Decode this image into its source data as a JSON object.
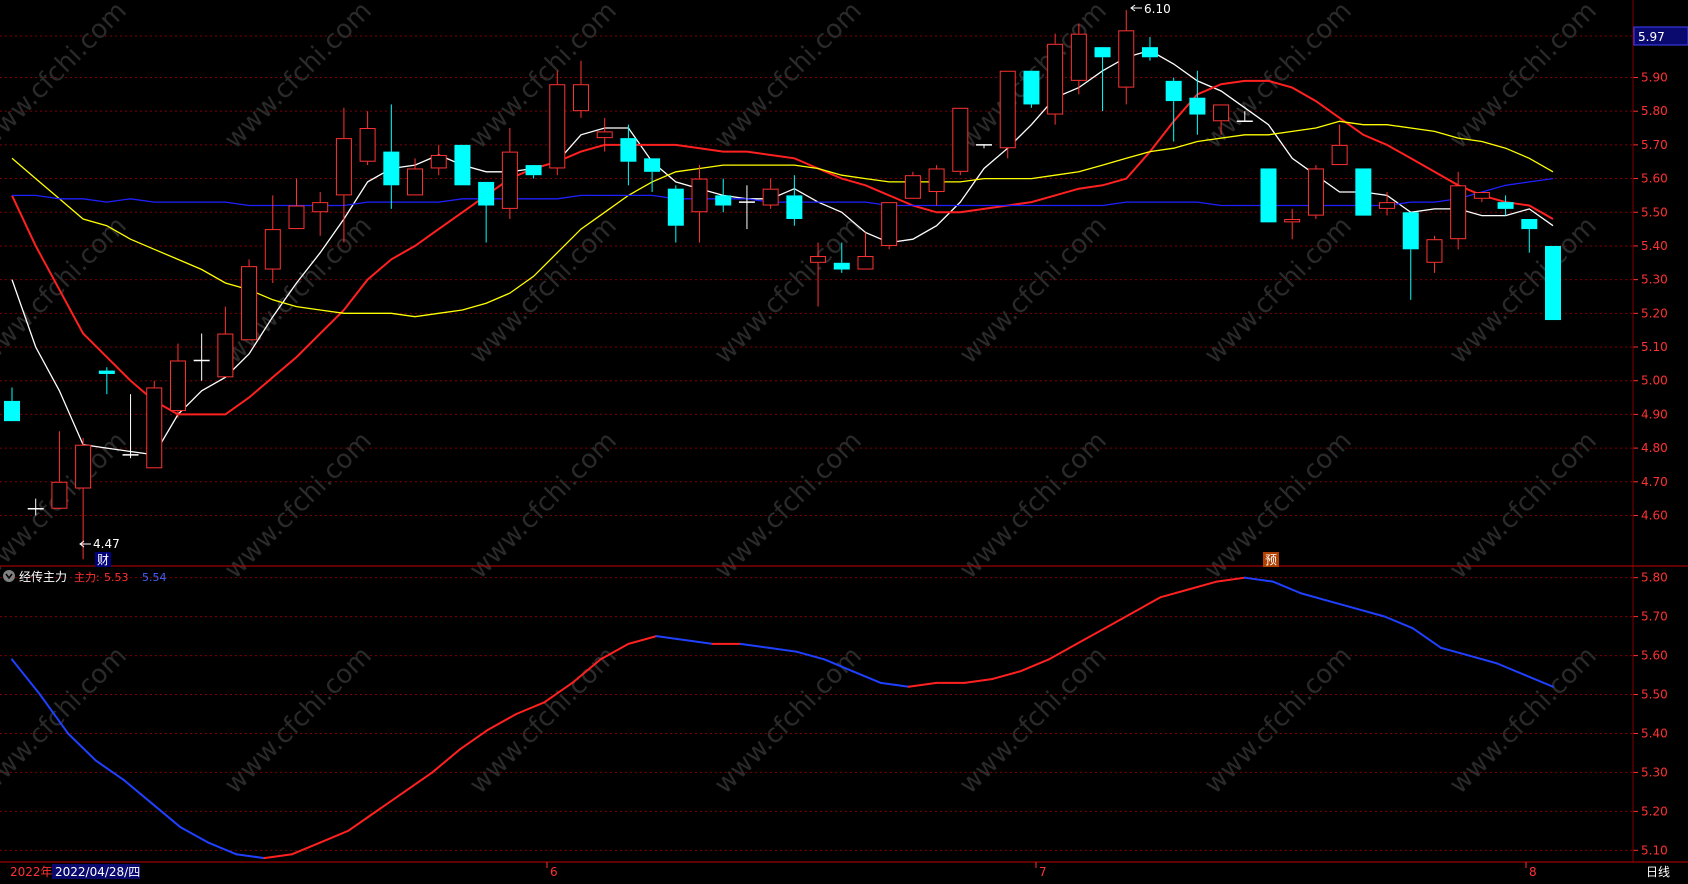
{
  "price_axis": {
    "labels": [
      "5.90",
      "5.80",
      "5.70",
      "5.60",
      "5.50",
      "5.40",
      "5.30",
      "5.20",
      "5.10",
      "5.00",
      "4.90",
      "4.80",
      "4.70",
      "4.60"
    ],
    "current_value": "5.97"
  },
  "indicator_axis": {
    "labels": [
      "5.80",
      "5.70",
      "5.60",
      "5.50",
      "5.40",
      "5.30",
      "5.20",
      "5.10"
    ]
  },
  "indicator_legend": {
    "name": "经传主力",
    "main_label": "主力:",
    "main_value": "5.53",
    "second_label": "",
    "second_value": "5.54"
  },
  "annotations": {
    "low_label": "4.47",
    "high_label": "6.10",
    "finance_marker": "财",
    "forecast_marker": "预"
  },
  "bottom_bar": {
    "year": "2022年",
    "date": "2022/04/28/四",
    "months": [
      "6",
      "7",
      "8"
    ],
    "period": "日线"
  },
  "colors": {
    "up": "#ff3232",
    "down": "#00ffff",
    "ma5": "#ffffff",
    "ma10": "#ff2020",
    "ma20": "#ffff00",
    "ma60": "#2020ff",
    "axis_text": "#ff3232",
    "grid": "#800000"
  },
  "chart_data": {
    "type": "candlestick",
    "period": "daily",
    "y_range": [
      4.45,
      6.13
    ],
    "candles": [
      {
        "o": 4.94,
        "h": 4.98,
        "l": 4.88,
        "c": 4.88
      },
      {
        "o": 4.62,
        "h": 4.65,
        "l": 4.6,
        "c": 4.62
      },
      {
        "o": 4.62,
        "h": 4.85,
        "l": 4.62,
        "c": 4.7
      },
      {
        "o": 4.68,
        "h": 4.83,
        "l": 4.47,
        "c": 4.81
      },
      {
        "o": 5.03,
        "h": 5.04,
        "l": 4.96,
        "c": 5.02
      },
      {
        "o": 4.78,
        "h": 4.96,
        "l": 4.77,
        "c": 4.78
      },
      {
        "o": 4.74,
        "h": 5.0,
        "l": 4.74,
        "c": 4.98
      },
      {
        "o": 4.91,
        "h": 5.11,
        "l": 4.89,
        "c": 5.06
      },
      {
        "o": 5.06,
        "h": 5.14,
        "l": 5.0,
        "c": 5.06
      },
      {
        "o": 5.01,
        "h": 5.22,
        "l": 5.01,
        "c": 5.14
      },
      {
        "o": 5.12,
        "h": 5.36,
        "l": 5.12,
        "c": 5.34
      },
      {
        "o": 5.33,
        "h": 5.55,
        "l": 5.29,
        "c": 5.45
      },
      {
        "o": 5.45,
        "h": 5.6,
        "l": 5.45,
        "c": 5.52
      },
      {
        "o": 5.5,
        "h": 5.56,
        "l": 5.43,
        "c": 5.53
      },
      {
        "o": 5.55,
        "h": 5.81,
        "l": 5.41,
        "c": 5.72
      },
      {
        "o": 5.65,
        "h": 5.8,
        "l": 5.64,
        "c": 5.75
      },
      {
        "o": 5.68,
        "h": 5.82,
        "l": 5.51,
        "c": 5.58
      },
      {
        "o": 5.55,
        "h": 5.66,
        "l": 5.55,
        "c": 5.63
      },
      {
        "o": 5.63,
        "h": 5.7,
        "l": 5.61,
        "c": 5.67
      },
      {
        "o": 5.7,
        "h": 5.7,
        "l": 5.58,
        "c": 5.58
      },
      {
        "o": 5.59,
        "h": 5.59,
        "l": 5.41,
        "c": 5.52
      },
      {
        "o": 5.51,
        "h": 5.75,
        "l": 5.48,
        "c": 5.68
      },
      {
        "o": 5.64,
        "h": 5.64,
        "l": 5.6,
        "c": 5.61
      },
      {
        "o": 5.63,
        "h": 5.92,
        "l": 5.61,
        "c": 5.88
      },
      {
        "o": 5.8,
        "h": 5.95,
        "l": 5.78,
        "c": 5.88
      },
      {
        "o": 5.72,
        "h": 5.78,
        "l": 5.68,
        "c": 5.74
      },
      {
        "o": 5.72,
        "h": 5.76,
        "l": 5.58,
        "c": 5.65
      },
      {
        "o": 5.66,
        "h": 5.66,
        "l": 5.56,
        "c": 5.62
      },
      {
        "o": 5.57,
        "h": 5.58,
        "l": 5.41,
        "c": 5.46
      },
      {
        "o": 5.5,
        "h": 5.64,
        "l": 5.41,
        "c": 5.6
      },
      {
        "o": 5.55,
        "h": 5.6,
        "l": 5.5,
        "c": 5.52
      },
      {
        "o": 5.53,
        "h": 5.58,
        "l": 5.45,
        "c": 5.53
      },
      {
        "o": 5.52,
        "h": 5.6,
        "l": 5.51,
        "c": 5.57
      },
      {
        "o": 5.55,
        "h": 5.61,
        "l": 5.46,
        "c": 5.48
      },
      {
        "o": 5.35,
        "h": 5.41,
        "l": 5.22,
        "c": 5.37
      },
      {
        "o": 5.35,
        "h": 5.41,
        "l": 5.32,
        "c": 5.33
      },
      {
        "o": 5.33,
        "h": 5.44,
        "l": 5.33,
        "c": 5.37
      },
      {
        "o": 5.4,
        "h": 5.53,
        "l": 5.39,
        "c": 5.53
      },
      {
        "o": 5.54,
        "h": 5.62,
        "l": 5.54,
        "c": 5.61
      },
      {
        "o": 5.56,
        "h": 5.64,
        "l": 5.52,
        "c": 5.63
      },
      {
        "o": 5.62,
        "h": 5.81,
        "l": 5.61,
        "c": 5.81
      },
      {
        "o": 5.7,
        "h": 5.7,
        "l": 5.69,
        "c": 5.7
      },
      {
        "o": 5.69,
        "h": 5.92,
        "l": 5.66,
        "c": 5.92
      },
      {
        "o": 5.92,
        "h": 5.92,
        "l": 5.81,
        "c": 5.82
      },
      {
        "o": 5.79,
        "h": 6.03,
        "l": 5.76,
        "c": 6.0
      },
      {
        "o": 5.89,
        "h": 6.06,
        "l": 5.85,
        "c": 6.03
      },
      {
        "o": 5.99,
        "h": 5.99,
        "l": 5.8,
        "c": 5.96
      },
      {
        "o": 5.87,
        "h": 6.1,
        "l": 5.82,
        "c": 6.04
      },
      {
        "o": 5.99,
        "h": 6.02,
        "l": 5.95,
        "c": 5.96
      },
      {
        "o": 5.89,
        "h": 5.9,
        "l": 5.71,
        "c": 5.83
      },
      {
        "o": 5.84,
        "h": 5.92,
        "l": 5.73,
        "c": 5.79
      },
      {
        "o": 5.77,
        "h": 5.82,
        "l": 5.73,
        "c": 5.82
      },
      {
        "o": 5.77,
        "h": 5.8,
        "l": 5.77,
        "c": 5.77
      },
      {
        "o": 5.63,
        "h": 5.63,
        "l": 5.47,
        "c": 5.47
      },
      {
        "o": 5.47,
        "h": 5.51,
        "l": 5.42,
        "c": 5.48
      },
      {
        "o": 5.49,
        "h": 5.64,
        "l": 5.48,
        "c": 5.63
      },
      {
        "o": 5.64,
        "h": 5.76,
        "l": 5.64,
        "c": 5.7
      },
      {
        "o": 5.63,
        "h": 5.63,
        "l": 5.49,
        "c": 5.49
      },
      {
        "o": 5.51,
        "h": 5.56,
        "l": 5.49,
        "c": 5.53
      },
      {
        "o": 5.5,
        "h": 5.5,
        "l": 5.24,
        "c": 5.39
      },
      {
        "o": 5.35,
        "h": 5.43,
        "l": 5.32,
        "c": 5.42
      },
      {
        "o": 5.42,
        "h": 5.62,
        "l": 5.39,
        "c": 5.58
      },
      {
        "o": 5.54,
        "h": 5.56,
        "l": 5.53,
        "c": 5.56
      },
      {
        "o": 5.53,
        "h": 5.55,
        "l": 5.49,
        "c": 5.51
      },
      {
        "o": 5.48,
        "h": 5.48,
        "l": 5.38,
        "c": 5.45
      },
      {
        "o": 5.4,
        "h": 5.4,
        "l": 5.18,
        "c": 5.18
      }
    ],
    "series": [
      {
        "type": "line",
        "color": "#ffffff",
        "values": [
          5.3,
          5.1,
          4.97,
          4.81,
          4.8,
          4.79,
          4.78,
          4.9,
          4.97,
          5.01,
          5.08,
          5.19,
          5.29,
          5.38,
          5.48,
          5.59,
          5.63,
          5.64,
          5.67,
          5.64,
          5.62,
          5.62,
          5.63,
          5.65,
          5.73,
          5.75,
          5.75,
          5.65,
          5.59,
          5.57,
          5.55,
          5.54,
          5.54,
          5.57,
          5.53,
          5.5,
          5.44,
          5.41,
          5.42,
          5.46,
          5.53,
          5.63,
          5.69,
          5.76,
          5.84,
          5.87,
          5.92,
          5.96,
          5.98,
          5.94,
          5.89,
          5.86,
          5.81,
          5.76,
          5.66,
          5.61,
          5.56,
          5.56,
          5.55,
          5.5,
          5.51,
          5.51,
          5.49,
          5.49,
          5.51,
          5.46
        ]
      },
      {
        "type": "line",
        "color": "#ff2020",
        "values": [
          5.55,
          5.4,
          5.27,
          5.14,
          5.07,
          5.0,
          4.94,
          4.9,
          4.9,
          4.9,
          4.95,
          5.01,
          5.07,
          5.14,
          5.21,
          5.3,
          5.36,
          5.4,
          5.45,
          5.5,
          5.55,
          5.6,
          5.63,
          5.65,
          5.68,
          5.7,
          5.7,
          5.7,
          5.7,
          5.69,
          5.68,
          5.68,
          5.67,
          5.66,
          5.63,
          5.6,
          5.58,
          5.55,
          5.52,
          5.5,
          5.5,
          5.51,
          5.52,
          5.53,
          5.55,
          5.57,
          5.58,
          5.6,
          5.68,
          5.77,
          5.85,
          5.88,
          5.89,
          5.89,
          5.87,
          5.83,
          5.78,
          5.73,
          5.7,
          5.66,
          5.62,
          5.58,
          5.55,
          5.53,
          5.52,
          5.48
        ]
      },
      {
        "type": "line",
        "color": "#ffff00",
        "values": [
          5.66,
          5.6,
          5.54,
          5.48,
          5.46,
          5.42,
          5.39,
          5.36,
          5.33,
          5.29,
          5.27,
          5.24,
          5.22,
          5.21,
          5.2,
          5.2,
          5.2,
          5.19,
          5.2,
          5.21,
          5.23,
          5.26,
          5.31,
          5.38,
          5.45,
          5.5,
          5.55,
          5.59,
          5.62,
          5.63,
          5.64,
          5.64,
          5.64,
          5.64,
          5.63,
          5.61,
          5.6,
          5.59,
          5.59,
          5.59,
          5.59,
          5.6,
          5.6,
          5.6,
          5.61,
          5.62,
          5.64,
          5.66,
          5.68,
          5.69,
          5.71,
          5.72,
          5.73,
          5.73,
          5.74,
          5.75,
          5.77,
          5.76,
          5.76,
          5.75,
          5.74,
          5.72,
          5.71,
          5.69,
          5.66,
          5.62
        ]
      },
      {
        "type": "line",
        "color": "#2020ff",
        "values": [
          5.55,
          5.55,
          5.54,
          5.54,
          5.53,
          5.54,
          5.53,
          5.53,
          5.53,
          5.53,
          5.52,
          5.52,
          5.52,
          5.52,
          5.52,
          5.53,
          5.53,
          5.53,
          5.53,
          5.54,
          5.54,
          5.54,
          5.54,
          5.54,
          5.55,
          5.55,
          5.55,
          5.55,
          5.54,
          5.54,
          5.54,
          5.54,
          5.53,
          5.53,
          5.53,
          5.53,
          5.53,
          5.52,
          5.52,
          5.52,
          5.52,
          5.52,
          5.52,
          5.52,
          5.52,
          5.52,
          5.52,
          5.53,
          5.53,
          5.53,
          5.53,
          5.52,
          5.52,
          5.52,
          5.52,
          5.52,
          5.52,
          5.52,
          5.52,
          5.53,
          5.53,
          5.54,
          5.56,
          5.58,
          5.59,
          5.6
        ]
      }
    ],
    "indicator": {
      "y_range": [
        5.07,
        5.83
      ],
      "values": [
        5.59,
        5.5,
        5.4,
        5.33,
        5.28,
        5.22,
        5.16,
        5.12,
        5.09,
        5.08,
        5.09,
        5.12,
        5.15,
        5.2,
        5.25,
        5.3,
        5.36,
        5.41,
        5.45,
        5.48,
        5.53,
        5.59,
        5.63,
        5.65,
        5.64,
        5.63,
        5.63,
        5.62,
        5.61,
        5.59,
        5.56,
        5.53,
        5.52,
        5.53,
        5.53,
        5.54,
        5.56,
        5.59,
        5.63,
        5.67,
        5.71,
        5.75,
        5.77,
        5.79,
        5.8,
        5.79,
        5.76,
        5.74,
        5.72,
        5.7,
        5.67,
        5.62,
        5.6,
        5.58,
        5.55,
        5.52
      ],
      "colors": {
        "rising": "#ff2020",
        "falling": "#2040ff"
      }
    }
  }
}
